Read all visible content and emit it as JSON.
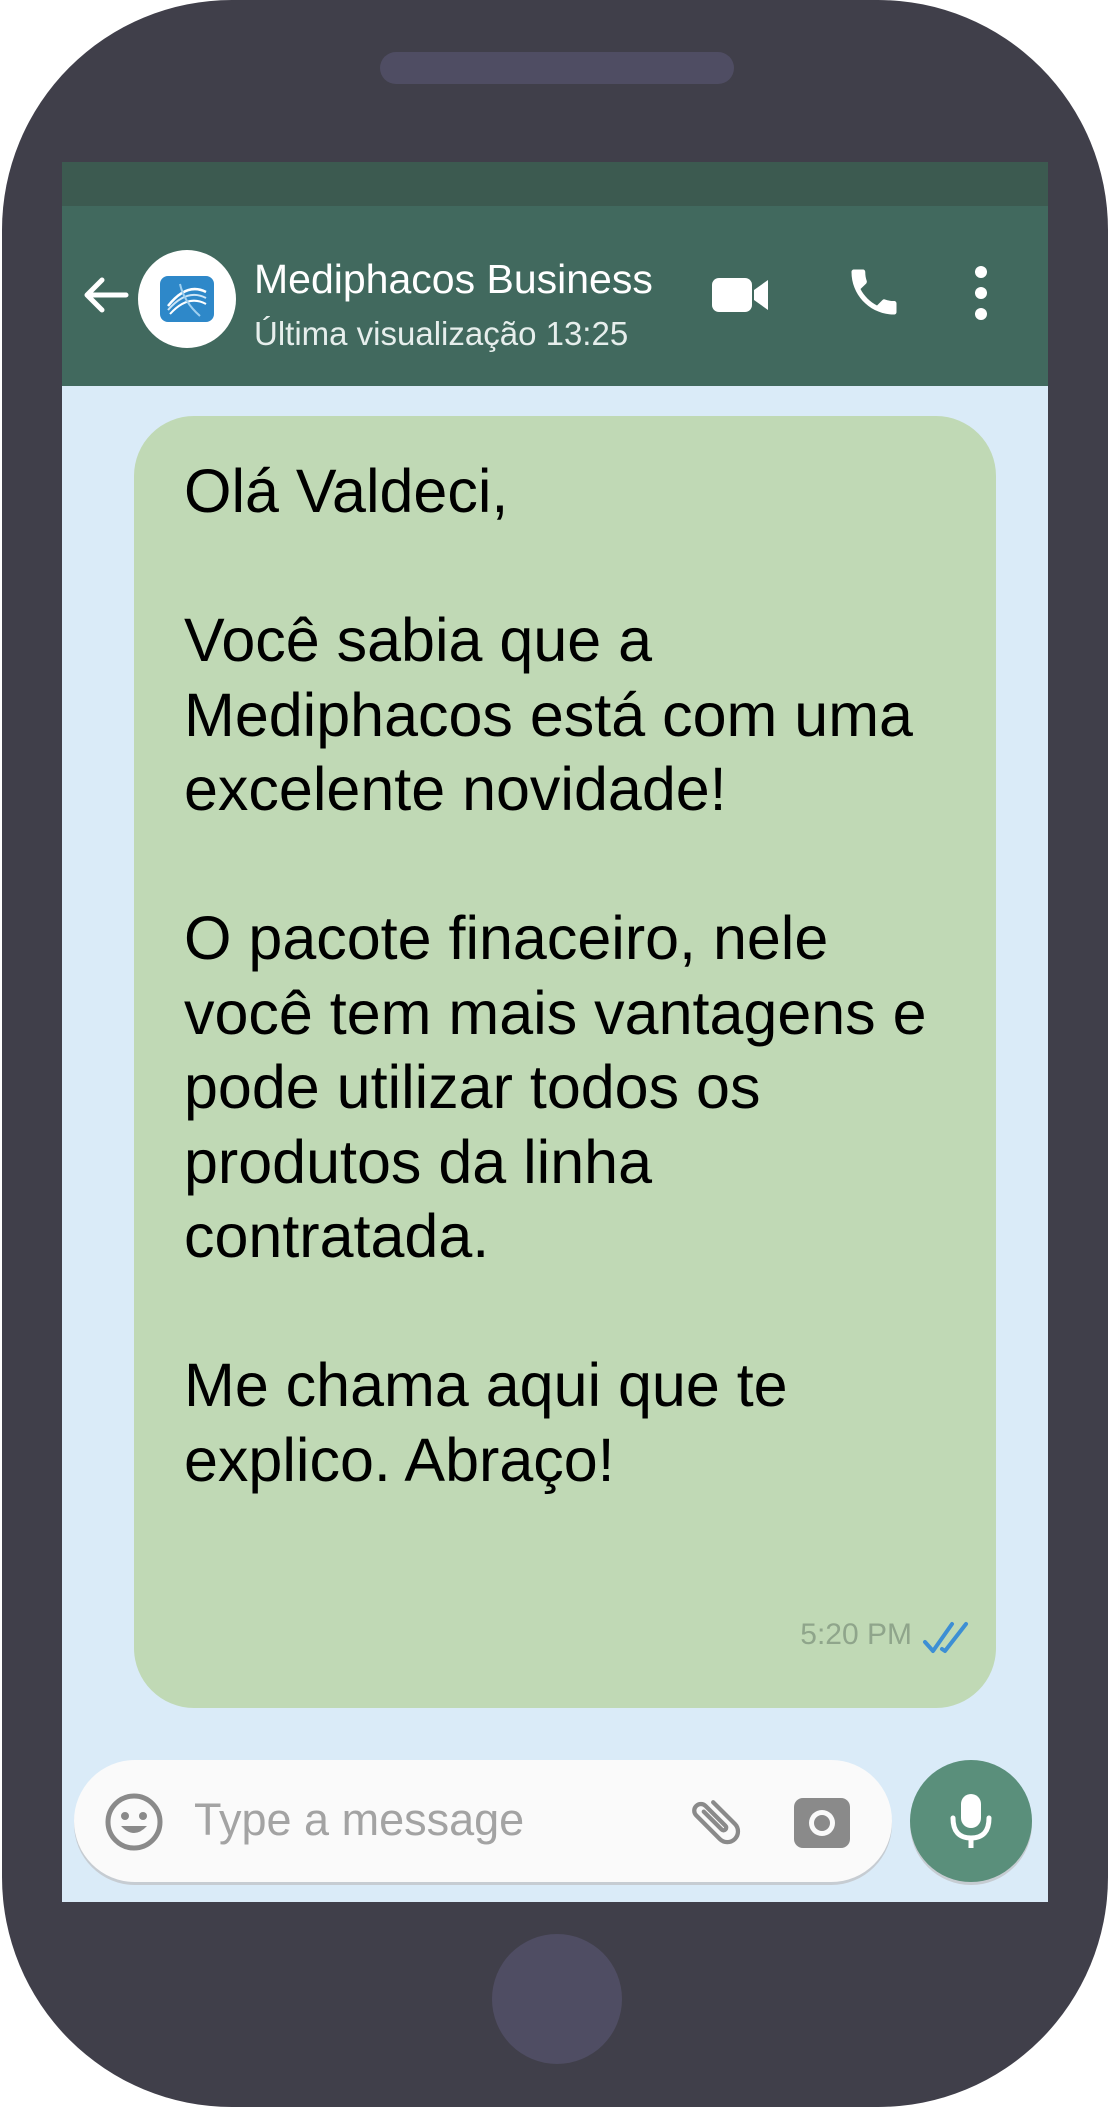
{
  "header": {
    "contact_name": "Mediphacos Business",
    "last_seen": "Última visualização 13:25"
  },
  "message": {
    "text": "Olá Valdeci,\n\nVocê sabia que a Mediphacos está com uma excelente novidade!\n\nO pacote finaceiro, nele você tem mais vantagens e pode utilizar todos os produtos da linha contratada.\n\nMe chama aqui que te explico. Abraço!",
    "time": "5:20 PM",
    "status": "read"
  },
  "composer": {
    "placeholder": "Type a message"
  },
  "icons": {
    "back": "arrow-left-icon",
    "video": "video-camera-icon",
    "call": "phone-icon",
    "menu": "more-vertical-icon",
    "emoji": "emoji-icon",
    "attach": "paperclip-icon",
    "camera": "camera-icon",
    "mic": "microphone-icon",
    "ticks": "double-check-icon"
  },
  "colors": {
    "header": "#41695e",
    "chat_background": "#daebf8",
    "bubble": "#c0d9b5",
    "mic_button": "#5a8f7b",
    "read_ticks": "#3d8fd4"
  }
}
